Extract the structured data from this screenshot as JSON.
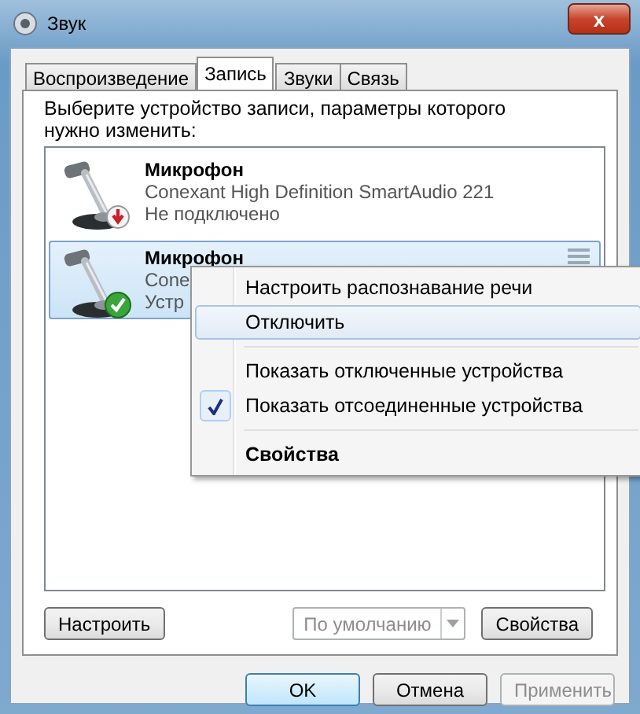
{
  "window": {
    "title": "Звук",
    "close": "x"
  },
  "tabs": [
    {
      "label": "Воспроизведение",
      "selected": false
    },
    {
      "label": "Запись",
      "selected": true
    },
    {
      "label": "Звуки",
      "selected": false
    },
    {
      "label": "Связь",
      "selected": false
    }
  ],
  "instruction": "Выберите устройство записи, параметры которого нужно изменить:",
  "devices": [
    {
      "name": "Микрофон",
      "driver": "Conexant High Definition SmartAudio 221",
      "status": "Не подключено",
      "kind": "unplugged",
      "selected": false
    },
    {
      "name": "Микрофон",
      "driver": "Cone",
      "status": "Устр",
      "kind": "default",
      "selected": true
    }
  ],
  "context_menu": [
    {
      "kind": "item",
      "label": "Настроить распознавание речи",
      "selected": false,
      "checked": false,
      "default": false
    },
    {
      "kind": "item",
      "label": "Отключить",
      "selected": true,
      "checked": false,
      "default": false
    },
    {
      "kind": "separator"
    },
    {
      "kind": "item",
      "label": "Показать отключенные устройства",
      "selected": false,
      "checked": false,
      "default": false
    },
    {
      "kind": "item",
      "label": "Показать отсоединенные устройства",
      "selected": false,
      "checked": true,
      "default": false
    },
    {
      "kind": "separator"
    },
    {
      "kind": "item",
      "label": "Свойства",
      "selected": false,
      "checked": false,
      "default": true
    }
  ],
  "configure_button": "Настроить",
  "default_dropdown": {
    "value": "По умолчанию",
    "disabled": true
  },
  "properties_button": "Свойства",
  "buttons": [
    {
      "label": "OK",
      "default": true,
      "disabled": false
    },
    {
      "label": "Отмена",
      "default": false,
      "disabled": false
    },
    {
      "label": "Применить",
      "default": false,
      "disabled": true
    }
  ]
}
